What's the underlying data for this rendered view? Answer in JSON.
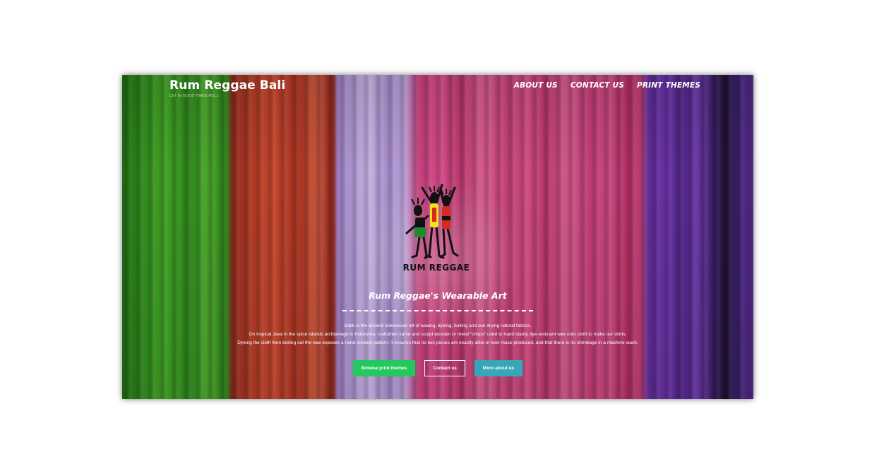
{
  "header": {
    "site_title": "Rum Reggae Bali",
    "tagline": "LET IN GOOD TIMES ROLL"
  },
  "nav": {
    "items": [
      {
        "label": "About us"
      },
      {
        "label": "Contact us"
      },
      {
        "label": "Print themes"
      }
    ]
  },
  "logo": {
    "text": "RUM REGGAE",
    "colors": [
      "#1f8a2e",
      "#f2e11c",
      "#d42a22",
      "#111111"
    ]
  },
  "hero": {
    "heading": "Rum Reggae's Wearable Art",
    "paragraphs": [
      "Batik is the ancient Indonesian art of waxing, dyeing, boiling and sun drying natural fabrics.",
      "On tropical Java in the spice islands archipelago in Indonesia, craftsmen carve and sculpt wooden or metal \"chops\" used to hand stamp dye-resistant wax onto cloth to make our shirts.",
      "Dyeing the cloth then boiling out the wax exposes a hand created pattern. It ensures that no two pieces are exactly alike or look mass-produced, and that there is no shrinkage in a machine wash."
    ]
  },
  "buttons": {
    "browse": "Browse print themes",
    "contact": "Contact us",
    "more": "More about us"
  },
  "colors": {
    "browse_button": "#23c95c",
    "more_button": "#37a7b8"
  }
}
